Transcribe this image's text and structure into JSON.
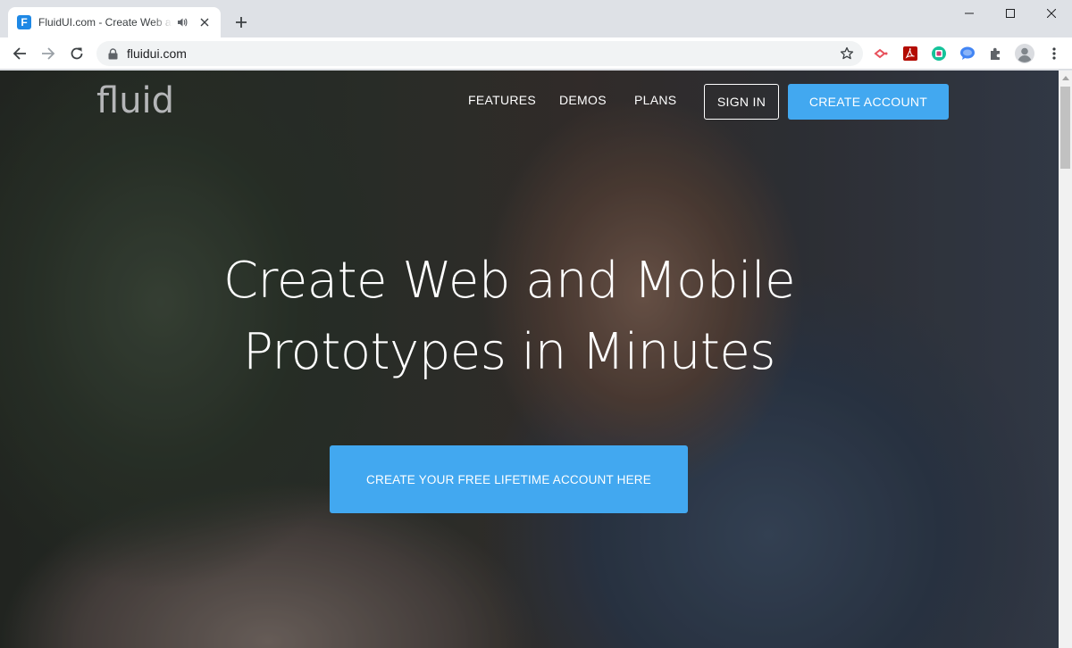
{
  "browser": {
    "tab": {
      "title": "FluidUI.com - Create Web and Mobile Prototypes in Minutes",
      "favicon_letter": "F"
    },
    "address": {
      "url": "fluidui.com"
    }
  },
  "site": {
    "logo": "fluid",
    "nav": {
      "features": "FEATURES",
      "demos": "DEMOS",
      "plans": "PLANS",
      "sign_in": "SIGN IN",
      "create_account": "CREATE ACCOUNT"
    },
    "headline": {
      "line1": "Create Web and Mobile",
      "line2": "Prototypes in Minutes"
    },
    "cta": "CREATE YOUR FREE LIFETIME ACCOUNT HERE"
  },
  "colors": {
    "accent": "#42a8f0",
    "tab_strip": "#dee1e6"
  },
  "icons": [
    "speaker-icon",
    "close-icon",
    "plus-icon",
    "minimize-icon",
    "maximize-icon",
    "window-close-icon",
    "back-icon",
    "forward-icon",
    "reload-icon",
    "lock-icon",
    "star-icon",
    "cast-icon",
    "pdf-icon",
    "grammarly-icon",
    "chat-icon",
    "extensions-icon",
    "avatar-icon",
    "menu-icon"
  ]
}
